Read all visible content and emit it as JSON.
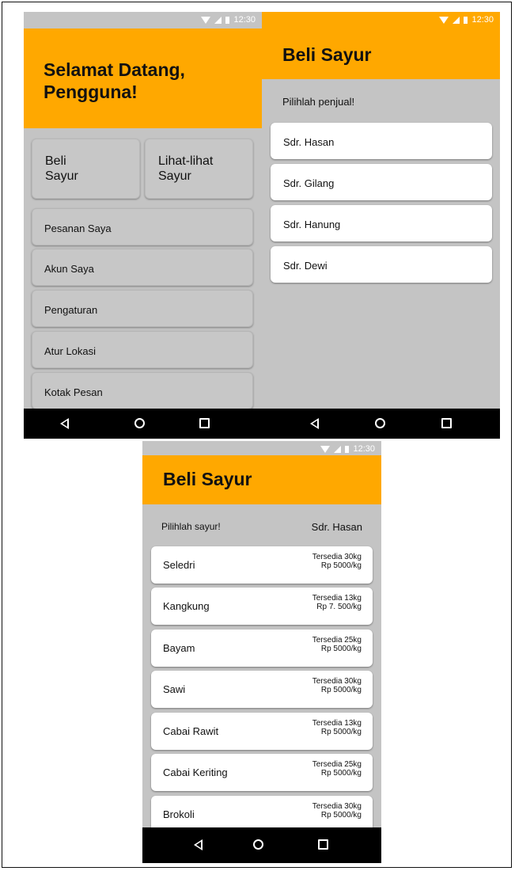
{
  "status": {
    "time": "12:30"
  },
  "screen1": {
    "greeting": "Selamat Datang, Pengguna!",
    "tile_beli": "Beli Sayur",
    "tile_lihat": "Lihat-lihat Sayur",
    "menu": [
      "Pesanan Saya",
      "Akun Saya",
      "Pengaturan",
      "Atur Lokasi",
      "Kotak Pesan"
    ]
  },
  "screen2": {
    "title": "Beli Sayur",
    "prompt": "Pilihlah penjual!",
    "sellers": [
      "Sdr. Hasan",
      "Sdr. Gilang",
      "Sdr. Hanung",
      "Sdr. Dewi"
    ]
  },
  "screen3": {
    "title": "Beli Sayur",
    "prompt": "Pilihlah sayur!",
    "seller": "Sdr. Hasan",
    "items": [
      {
        "name": "Seledri",
        "stock": "Tersedia 30kg",
        "price": "Rp 5000/kg"
      },
      {
        "name": "Kangkung",
        "stock": "Tersedia 13kg",
        "price": "Rp 7. 500/kg"
      },
      {
        "name": "Bayam",
        "stock": "Tersedia 25kg",
        "price": "Rp 5000/kg"
      },
      {
        "name": "Sawi",
        "stock": "Tersedia 30kg",
        "price": "Rp 5000/kg"
      },
      {
        "name": "Cabai Rawit",
        "stock": "Tersedia 13kg",
        "price": "Rp 5000/kg"
      },
      {
        "name": "Cabai Keriting",
        "stock": "Tersedia 25kg",
        "price": "Rp 5000/kg"
      },
      {
        "name": "Brokoli",
        "stock": "Tersedia 30kg",
        "price": "Rp 5000/kg"
      }
    ]
  },
  "colors": {
    "accent": "#ffa800",
    "background": "#c4c4c4",
    "navbar": "#000000"
  },
  "icons": {
    "nav": [
      "back-icon",
      "home-icon",
      "recent-apps-icon"
    ],
    "status": [
      "wifi-icon",
      "signal-icon",
      "battery-icon"
    ]
  }
}
